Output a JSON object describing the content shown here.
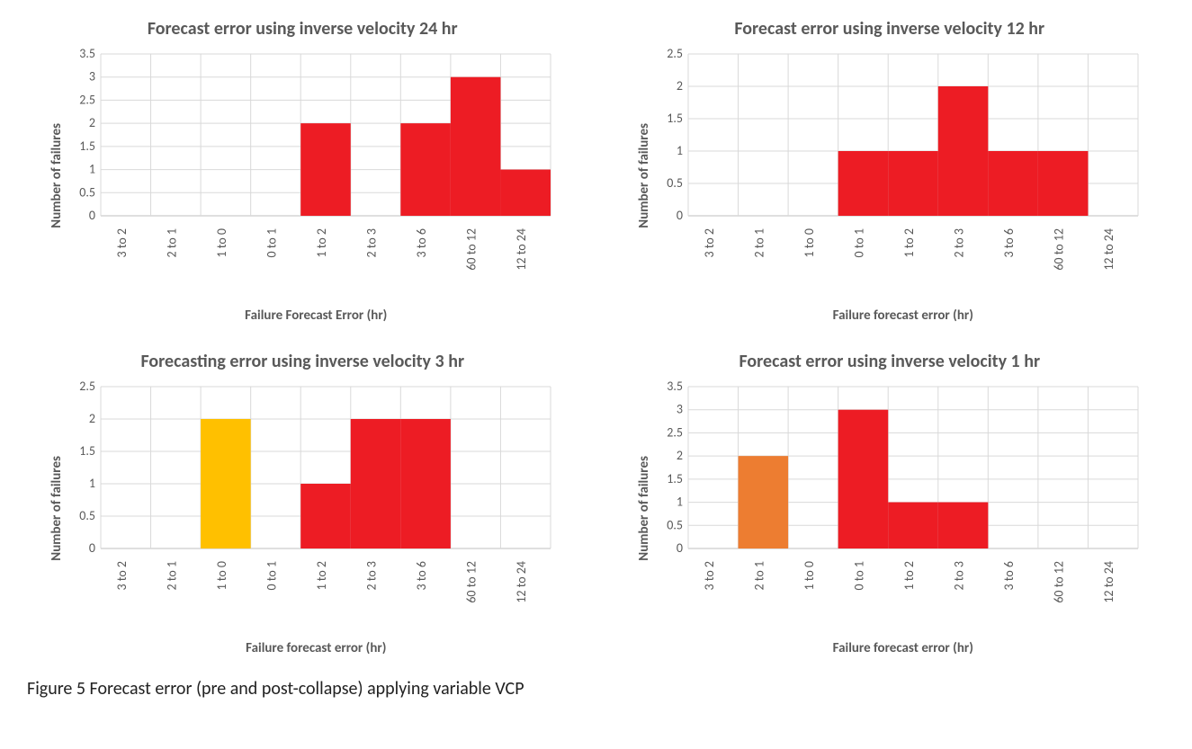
{
  "caption": "Figure 5    Forecast error (pre and post-collapse) applying variable VCP",
  "chart_data": [
    {
      "type": "bar",
      "title": "Forecast error using inverse velocity 24 hr",
      "xlabel": "Failure Forecast Error (hr)",
      "ylabel": "Number of failures",
      "ylim": [
        0,
        3.5
      ],
      "ystep": 0.5,
      "categories": [
        "3 to 2",
        "2 to 1",
        "1 to 0",
        "0 to 1",
        "1 to 2",
        "2 to 3",
        "3 to 6",
        "60 to 12",
        "12 to 24"
      ],
      "series": [
        {
          "name": "red",
          "color": "#ed1c24",
          "values": [
            0,
            0,
            0,
            0,
            2,
            0,
            2,
            3,
            1
          ]
        }
      ]
    },
    {
      "type": "bar",
      "title": "Forecast error using inverse velocity 12 hr",
      "xlabel": "Failure forecast error (hr)",
      "ylabel": "Number of failures",
      "ylim": [
        0,
        2.5
      ],
      "ystep": 0.5,
      "categories": [
        "3 to 2",
        "2 to 1",
        "1 to 0",
        "0 to 1",
        "1 to 2",
        "2 to 3",
        "3 to 6",
        "60 to 12",
        "12 to 24"
      ],
      "series": [
        {
          "name": "red",
          "color": "#ed1c24",
          "values": [
            0,
            0,
            0,
            1,
            1,
            2,
            1,
            1,
            0
          ]
        }
      ]
    },
    {
      "type": "bar",
      "title": "Forecasting error using inverse velocity 3 hr",
      "xlabel": "Failure forecast error (hr)",
      "ylabel": "Number of failures",
      "ylim": [
        0,
        2.5
      ],
      "ystep": 0.5,
      "categories": [
        "3 to 2",
        "2 to 1",
        "1 to 0",
        "0 to 1",
        "1 to 2",
        "2 to 3",
        "3 to 6",
        "60 to 12",
        "12 to 24"
      ],
      "series": [
        {
          "name": "yellow",
          "color": "#ffc000",
          "values": [
            0,
            0,
            2,
            0,
            0,
            0,
            0,
            0,
            0
          ]
        },
        {
          "name": "red",
          "color": "#ed1c24",
          "values": [
            0,
            0,
            0,
            0,
            1,
            2,
            2,
            0,
            0
          ]
        }
      ]
    },
    {
      "type": "bar",
      "title": "Forecast error using inverse velocity 1 hr",
      "xlabel": "Failure forecast error (hr)",
      "ylabel": "Number of failures",
      "ylim": [
        0,
        3.5
      ],
      "ystep": 0.5,
      "categories": [
        "3 to 2",
        "2 to 1",
        "1 to 0",
        "0 to 1",
        "1 to 2",
        "2 to 3",
        "3 to 6",
        "60 to 12",
        "12 to 24"
      ],
      "series": [
        {
          "name": "orange",
          "color": "#ed7d31",
          "values": [
            0,
            2,
            0,
            0,
            0,
            0,
            0,
            0,
            0
          ]
        },
        {
          "name": "red",
          "color": "#ed1c24",
          "values": [
            0,
            0,
            0,
            3,
            1,
            1,
            0,
            0,
            0
          ]
        }
      ]
    }
  ]
}
